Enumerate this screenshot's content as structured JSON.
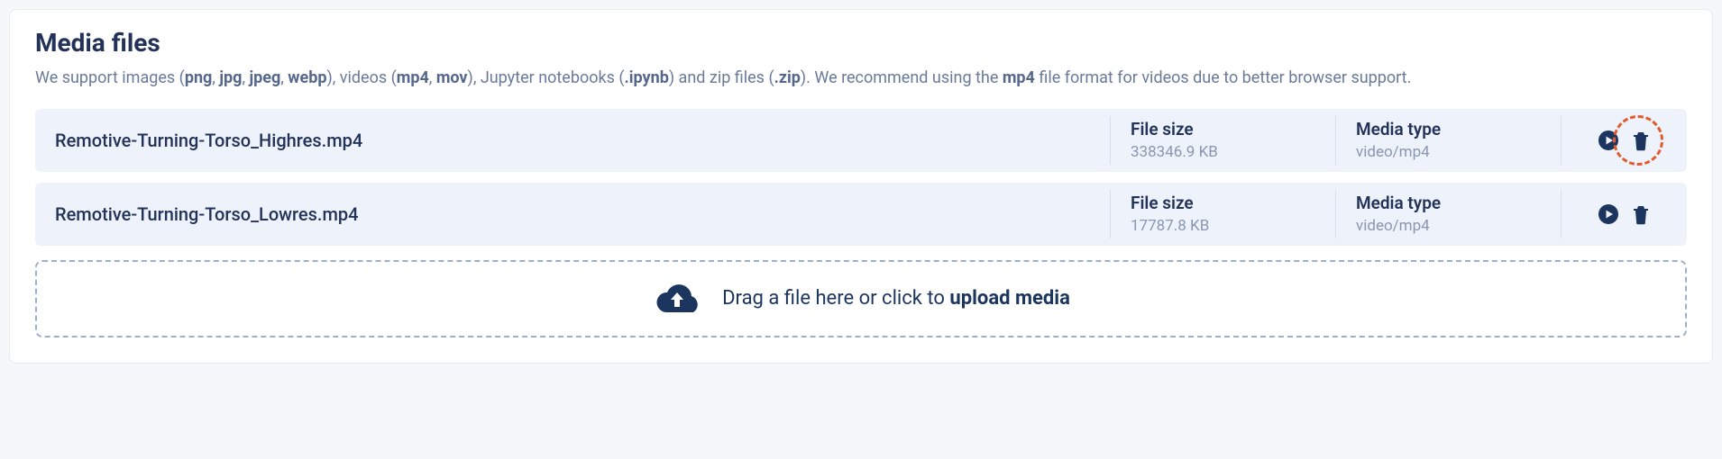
{
  "section": {
    "title": "Media files",
    "description_parts": [
      "We support images (",
      "png",
      ", ",
      "jpg",
      ", ",
      "jpeg",
      ", ",
      "webp",
      "), videos (",
      "mp4",
      ", ",
      "mov",
      "), Jupyter notebooks (",
      ".ipynb",
      ") and zip files (",
      ".zip",
      "). We recommend using the ",
      "mp4",
      " file format for videos due to better browser support."
    ]
  },
  "labels": {
    "file_size": "File size",
    "media_type": "Media type"
  },
  "files": [
    {
      "name": "Remotive-Turning-Torso_Highres.mp4",
      "size": "338346.9 KB",
      "media_type": "video/mp4",
      "highlighted": true
    },
    {
      "name": "Remotive-Turning-Torso_Lowres.mp4",
      "size": "17787.8 KB",
      "media_type": "video/mp4",
      "highlighted": false
    }
  ],
  "dropzone": {
    "text_prefix": "Drag a file here or click to ",
    "text_strong": "upload media"
  },
  "colors": {
    "accent": "#1c355e",
    "row_bg": "#edf2fb",
    "highlight": "#e25b2d"
  }
}
